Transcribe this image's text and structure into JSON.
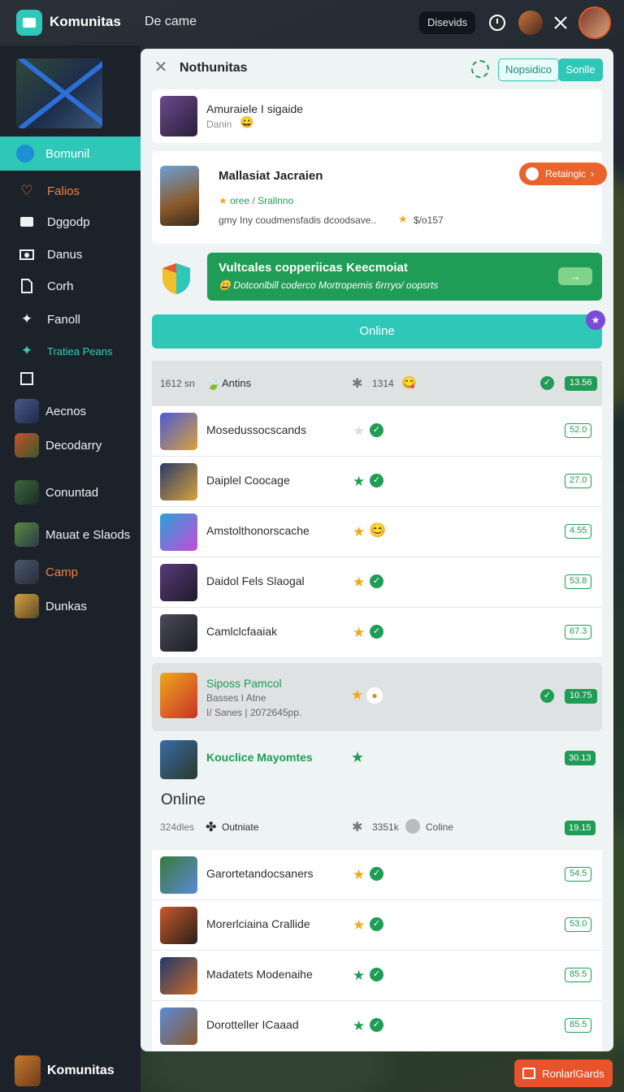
{
  "topbar": {
    "app_title": "Komunitas",
    "subtitle": "De came",
    "pill_label": "Disevids"
  },
  "sidebar": {
    "active_label": "Bomunil",
    "items": [
      {
        "label": "Falios",
        "icon": "heart-icon",
        "color": "#f0803c"
      },
      {
        "label": "Dggodp",
        "icon": "folder-icon",
        "color": "#eef1f3"
      },
      {
        "label": "Danus",
        "icon": "camera-icon",
        "color": "#eef1f3"
      },
      {
        "label": "Corh",
        "icon": "document-icon",
        "color": "#eef1f3"
      },
      {
        "label": "Fanoll",
        "icon": "person-icon",
        "color": "#eef1f3"
      },
      {
        "label": "Tratiea Peans",
        "icon": "person-icon",
        "color": "#3fc9b9"
      },
      {
        "label": "",
        "icon": "square-icon",
        "color": "#eef1f3"
      }
    ],
    "games": [
      {
        "label": "Aecnos",
        "color": "#eef1f3"
      },
      {
        "label": "Decodarry",
        "color": "#eef1f3"
      },
      {
        "label": "Conuntad",
        "color": "#eef1f3"
      },
      {
        "label": "Mauat e Slaods",
        "color": "#eef1f3"
      },
      {
        "label": "Camp",
        "color": "#f0803c"
      },
      {
        "label": "Dunkas",
        "color": "#eef1f3"
      }
    ],
    "footer_label": "Komunitas"
  },
  "panel": {
    "title": "Nothunitas",
    "outline_button": "Nopsidico",
    "fill_button": "Sonlle",
    "card1": {
      "title": "Amuraiele I sigaide",
      "sub": "Danin"
    },
    "card2": {
      "title": "Mallasiat Jacraien",
      "rating_text": "oree / Srallnno",
      "desc": "gmy Iny coudmensfadis dcoodsave..",
      "count": "$/o157",
      "button": "Retaingic"
    },
    "banner": {
      "title": "Vultcales copperiicas Keecmoiat",
      "desc": "Dotconlbill coderco Mortropemis 6rrryo/ oopsrts"
    },
    "online_button": "Online",
    "header_row": {
      "left": "1612 sn",
      "name": "Antins",
      "count": "1314",
      "badge": "13.56"
    },
    "rows": [
      {
        "name": "Mosedussocscands",
        "badge": "52.0",
        "star": "gray"
      },
      {
        "name": "Daiplel Coocage",
        "badge": "27.0",
        "star": "green"
      },
      {
        "name": "Amstolthonorscache",
        "badge": "4.55",
        "star": "gold"
      },
      {
        "name": "Daidol Fels Slaogal",
        "badge": "53.8",
        "star": "gold"
      },
      {
        "name": "Camlclcfaaiak",
        "badge": "67.3",
        "star": "gold"
      }
    ],
    "highlight_row": {
      "title": "Siposs Pamcol",
      "sub1": "Basses I Atne",
      "sub2": "I/ Sanes | 2072645pp.",
      "badge": "10.75"
    },
    "feature_row": {
      "title": "Kouclice Mayomtes",
      "badge": "30.13"
    },
    "section_title": "Online",
    "section_row": {
      "left": "324dles",
      "name": "Outniate",
      "count": "3351k",
      "status": "Coline",
      "badge": "19.15"
    },
    "rows2": [
      {
        "name": "Garortetandocsaners",
        "badge": "54.5",
        "star": "gold"
      },
      {
        "name": "Morerlciaina Crallide",
        "badge": "53.0",
        "star": "gold"
      },
      {
        "name": "Madatets Modenaihe",
        "badge": "85.5",
        "star": "green"
      },
      {
        "name": "Dorotteller ICaaad",
        "badge": "85.5",
        "star": "green"
      }
    ]
  },
  "footer_button": "RonlarlGards",
  "colors": {
    "accent": "#2ec7b8",
    "green": "#1f9c55",
    "orange": "#e8532c"
  }
}
